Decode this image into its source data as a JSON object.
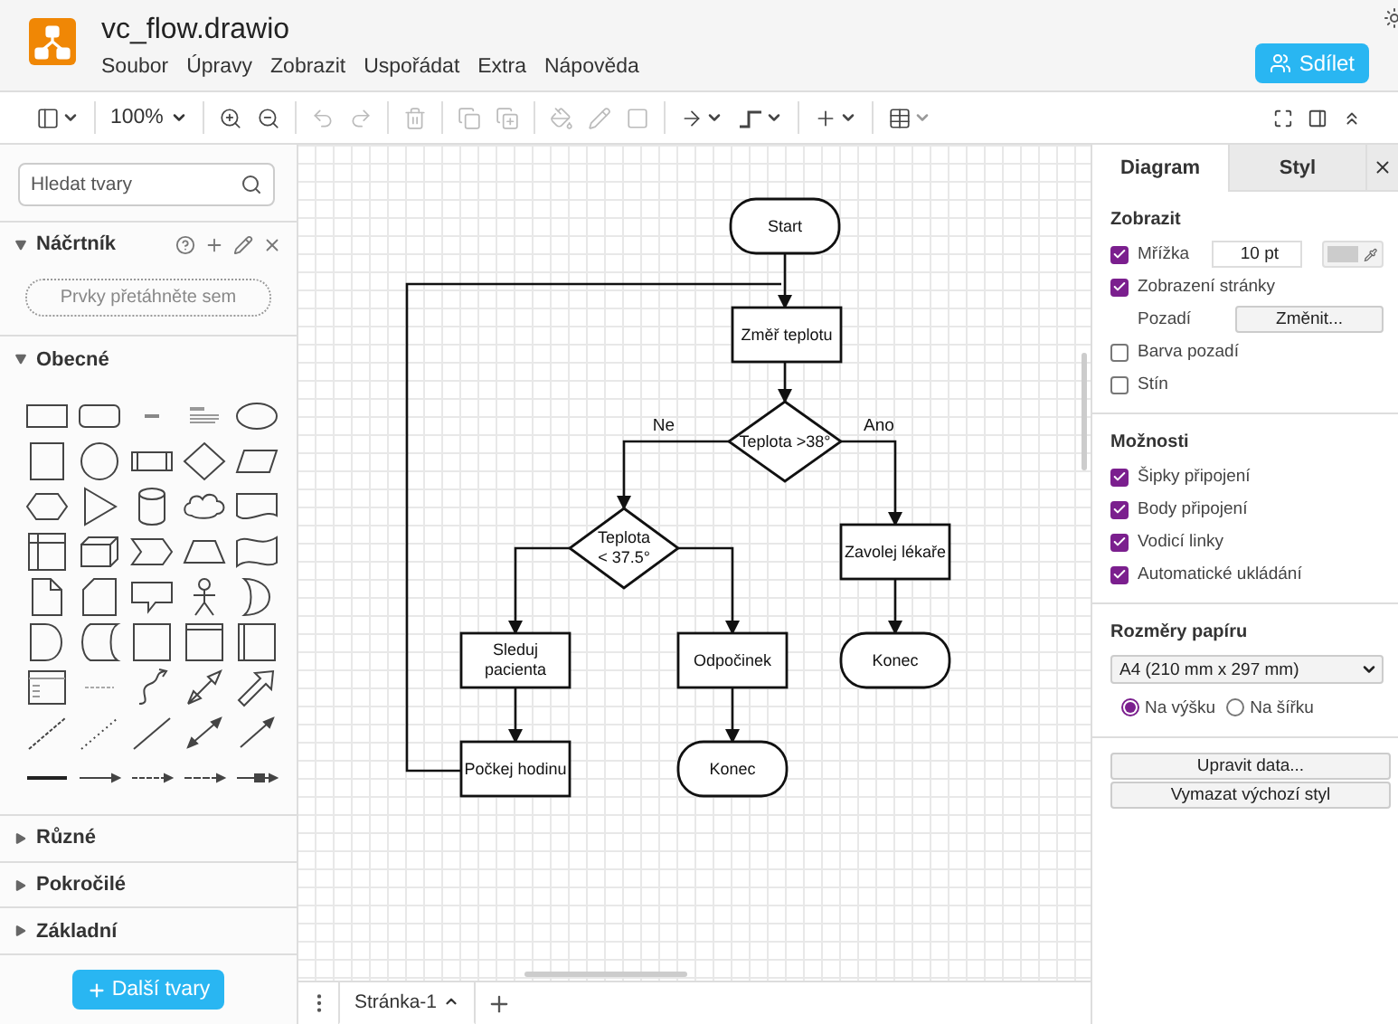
{
  "app": {
    "file_name": "vc_flow.drawio",
    "menu": [
      "Soubor",
      "Úpravy",
      "Zobrazit",
      "Uspořádat",
      "Extra",
      "Nápověda"
    ],
    "share_button": "Sdílet"
  },
  "toolbar": {
    "zoom": "100%"
  },
  "sidebar": {
    "search": {
      "placeholder": "Hledat tvary"
    },
    "sections": [
      {
        "title": "Náčrtník",
        "expanded": true,
        "kind": "scratchpad",
        "drop_hint": "Prvky přetáhněte sem"
      },
      {
        "title": "Obecné",
        "expanded": true,
        "kind": "shapes"
      },
      {
        "title": "Různé",
        "expanded": false
      },
      {
        "title": "Pokročilé",
        "expanded": false
      },
      {
        "title": "Základní",
        "expanded": false
      }
    ],
    "more_button": "Další tvary"
  },
  "diagram": {
    "nodes": [
      {
        "kind": "terminal",
        "text": "Start"
      },
      {
        "kind": "process",
        "text": "Změř teplotu"
      },
      {
        "kind": "decision",
        "text": "Teplota >38°"
      },
      {
        "kind": "decision",
        "text": "Teplota\n< 37.5°"
      },
      {
        "kind": "process",
        "text": "Zavolej lékaře"
      },
      {
        "kind": "process",
        "text": "Sleduj\npacienta"
      },
      {
        "kind": "process",
        "text": "Odpočinek"
      },
      {
        "kind": "terminal",
        "text": "Konec"
      },
      {
        "kind": "process",
        "text": "Počkej hodinu"
      },
      {
        "kind": "terminal",
        "text": "Konec"
      }
    ],
    "edge_labels": [
      "Ne",
      "Ano"
    ]
  },
  "page_tabs": [
    {
      "label": "Stránka-1",
      "selected": true
    }
  ],
  "format_panel": {
    "tabs": [
      {
        "label": "Diagram",
        "selected": true
      },
      {
        "label": "Styl",
        "selected": false
      }
    ],
    "sections": [
      {
        "title": "Zobrazit",
        "rows": [
          {
            "kind": "grid",
            "label": "Mřížka",
            "checked": true,
            "value": "10 pt"
          },
          {
            "kind": "checkbox",
            "label": "Zobrazení stránky",
            "checked": true
          },
          {
            "kind": "button",
            "label": "Pozadí",
            "button": "Změnit..."
          },
          {
            "kind": "checkbox",
            "label": "Barva pozadí",
            "checked": false
          },
          {
            "kind": "checkbox",
            "label": "Stín",
            "checked": false
          }
        ]
      },
      {
        "title": "Možnosti",
        "rows": [
          {
            "kind": "checkbox",
            "label": "Šipky připojení",
            "checked": true
          },
          {
            "kind": "checkbox",
            "label": "Body připojení",
            "checked": true
          },
          {
            "kind": "checkbox",
            "label": "Vodicí linky",
            "checked": true
          },
          {
            "kind": "checkbox",
            "label": "Automatické ukládání",
            "checked": true
          }
        ]
      },
      {
        "title": "Rozměry papíru",
        "rows": [
          {
            "kind": "select",
            "value": "A4 (210 mm x 297 mm)"
          },
          {
            "kind": "radios",
            "options": [
              {
                "label": "Na výšku",
                "selected": true
              },
              {
                "label": "Na šířku",
                "selected": false
              }
            ]
          }
        ]
      }
    ],
    "buttons": [
      "Upravit data...",
      "Vymazat výchozí styl"
    ]
  }
}
